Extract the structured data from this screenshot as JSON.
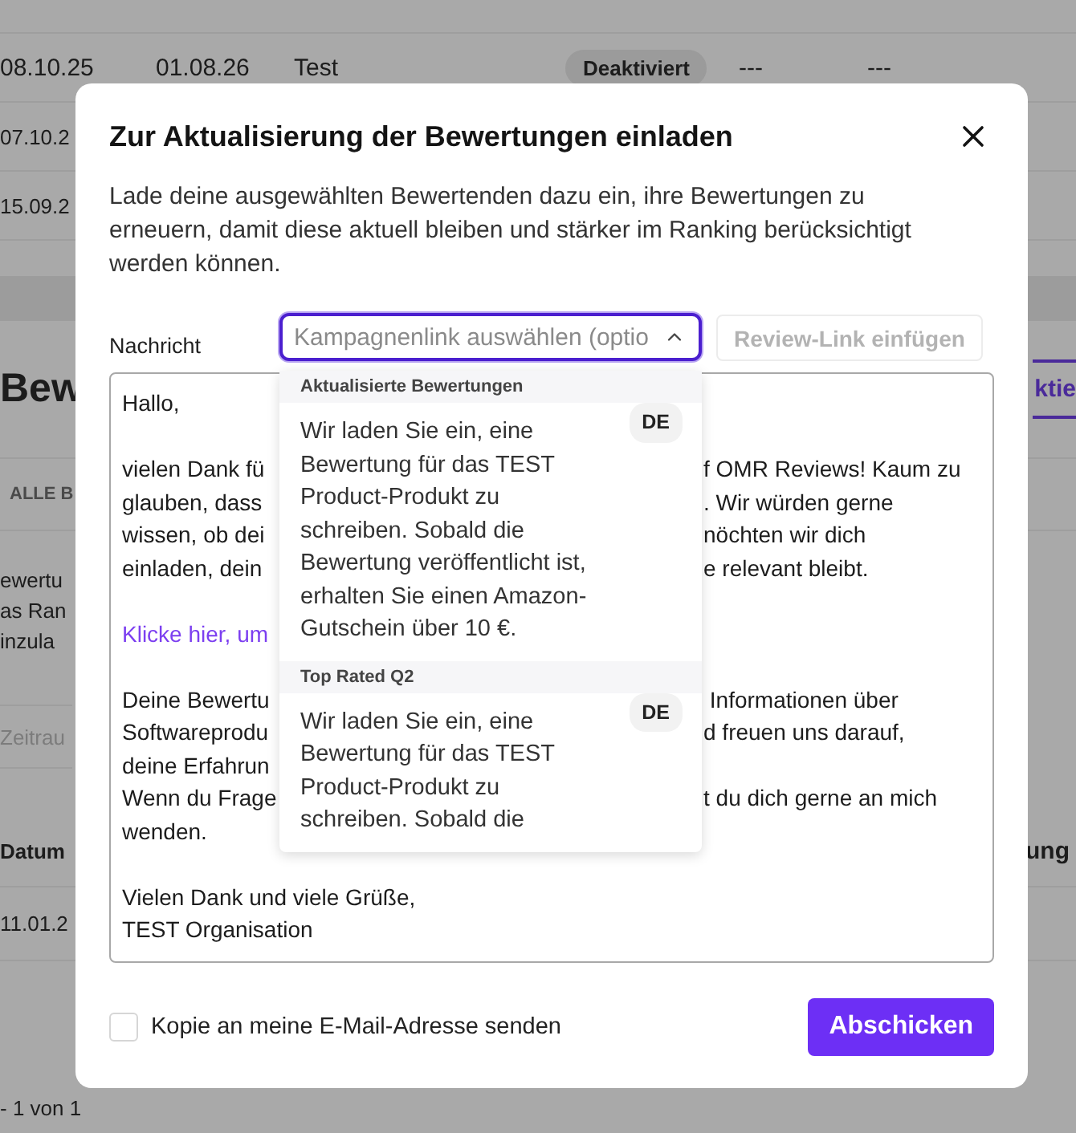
{
  "background": {
    "table_rows": [
      {
        "start": "08.10.25",
        "end": "01.08.26",
        "name": "Test",
        "status": {
          "label": "Deaktiviert",
          "kind": "inactive"
        },
        "column_5": "---",
        "column_6": "---"
      },
      {
        "start": "07.10.2"
      },
      {
        "start": "15.09.2"
      }
    ],
    "heading": "Bew",
    "action_button": "ktie",
    "tab": "ALLE B",
    "text_lines": [
      "ewertu",
      "as Ran",
      "inzula"
    ],
    "filter_placeholder": "Zeitrau",
    "second_table": {
      "columns": [
        "Datum",
        "ung"
      ],
      "rows": [
        "11.01.2"
      ]
    },
    "pagination": "- 1 von 1"
  },
  "dialog": {
    "title": "Zur Aktualisierung der Bewertungen einladen",
    "description": "Lade deine ausgewählten Bewertenden dazu ein, ihre Bewertungen zu erneuern, damit diese aktuell bleiben und stärker im Ranking berücksichtigt werden können.",
    "message_label": "Nachricht",
    "campaign_select": {
      "placeholder": "Kampagnenlink auswählen (optio",
      "expanded": true,
      "options": [
        {
          "group": "Aktualisierte Bewertungen",
          "language": "DE",
          "text": "Wir laden Sie ein, eine Bewertung für das TEST Product-Produkt zu schreiben. Sobald die Bewertung veröffentlicht ist, erhalten Sie einen Amazon-Gutschein über 10 €."
        },
        {
          "group": "Top Rated Q2",
          "language": "DE",
          "text": "Wir laden Sie ein, eine Bewertung für das TEST Product-Produkt zu schreiben. Sobald die"
        }
      ]
    },
    "insert_button": {
      "label": "Review-Link einfügen",
      "disabled": true
    },
    "message_lines": [
      {
        "kind": "text",
        "left": "Hallo,"
      },
      {
        "kind": "blank"
      },
      {
        "kind": "text",
        "left": "vielen Dank fü",
        "right": "f OMR Reviews! Kaum zu"
      },
      {
        "kind": "text",
        "left": "glauben, dass",
        "right": ". Wir würden gerne"
      },
      {
        "kind": "text",
        "left": "wissen, ob dei",
        "right": "nöchten wir dich"
      },
      {
        "kind": "text",
        "left": "einladen, dein",
        "right": "e relevant bleibt."
      },
      {
        "kind": "blank"
      },
      {
        "kind": "link",
        "left": "Klicke hier, um"
      },
      {
        "kind": "blank"
      },
      {
        "kind": "text",
        "left": "Deine Bewertu",
        "right": " Informationen über"
      },
      {
        "kind": "text",
        "left": "Softwareprodu",
        "right": "d freuen uns darauf,"
      },
      {
        "kind": "text",
        "left": "deine Erfahrun"
      },
      {
        "kind": "text",
        "left": "Wenn du Frage",
        "right": "t du dich gerne an mich"
      },
      {
        "kind": "text",
        "left": "wenden."
      },
      {
        "kind": "blank"
      },
      {
        "kind": "text",
        "left": "Vielen Dank und viele Grüße,"
      },
      {
        "kind": "text",
        "left": "TEST Organisation"
      }
    ],
    "copy_checkbox": {
      "label": "Kopie an meine E-Mail-Adresse senden",
      "checked": false
    },
    "submit_button": "Abschicken"
  }
}
